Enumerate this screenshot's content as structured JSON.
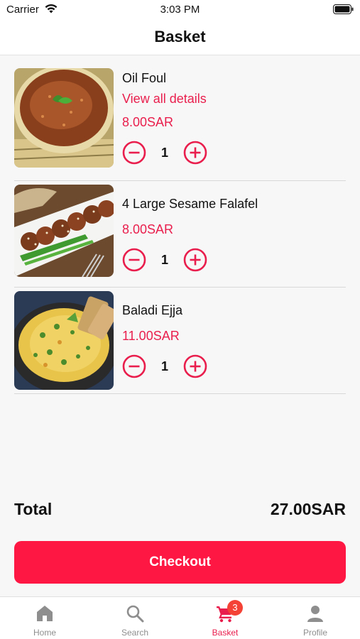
{
  "status_bar": {
    "carrier": "Carrier",
    "time": "3:03 PM"
  },
  "header": {
    "title": "Basket"
  },
  "items": [
    {
      "name": "Oil Foul",
      "details_link": "View all details",
      "price": "8.00SAR",
      "quantity": "1"
    },
    {
      "name": "4 Large Sesame Falafel",
      "price": "8.00SAR",
      "quantity": "1"
    },
    {
      "name": "Baladi Ejja",
      "price": "11.00SAR",
      "quantity": "1"
    }
  ],
  "summary": {
    "total_label": "Total",
    "total_amount": "27.00SAR"
  },
  "checkout": {
    "label": "Checkout"
  },
  "tab_bar": {
    "tabs": [
      {
        "label": "Home",
        "icon": "home-icon"
      },
      {
        "label": "Search",
        "icon": "search-icon"
      },
      {
        "label": "Basket",
        "icon": "cart-icon",
        "badge": "3",
        "active": true
      },
      {
        "label": "Profile",
        "icon": "person-icon"
      }
    ]
  },
  "colors": {
    "accent": "#e91e4c",
    "checkout": "#ff1744",
    "badge": "#f44336",
    "inactive": "#8e8e8e"
  }
}
